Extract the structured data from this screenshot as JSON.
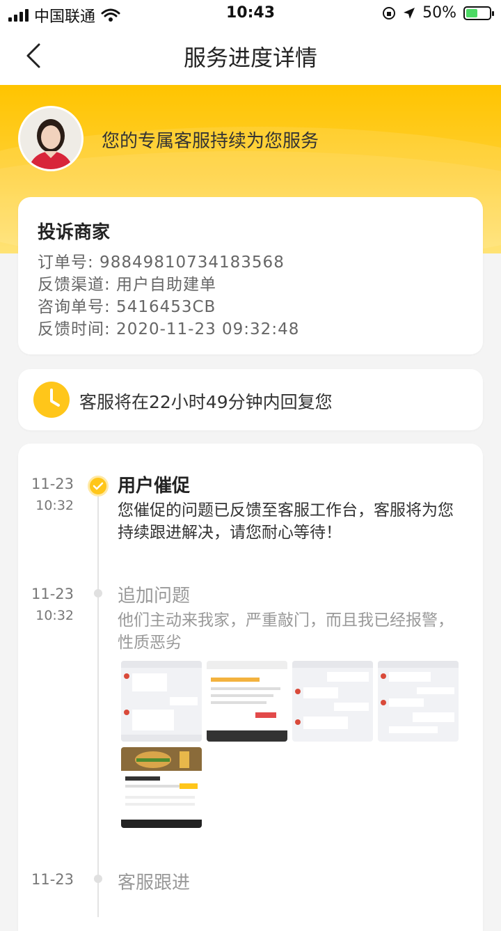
{
  "status_bar": {
    "carrier": "中国联通",
    "time": "10:43",
    "battery": "50%",
    "battery_level": 0.5
  },
  "nav": {
    "title": "服务进度详情",
    "back_icon": "chevron-left-icon"
  },
  "header": {
    "message": "您的专属客服持续为您服务"
  },
  "complaint": {
    "title": "投诉商家",
    "order_no": "订单号: 98849810734183568",
    "channel": "反馈渠道: 用户自助建单",
    "inquiry_no": "咨询单号: 5416453CB",
    "feedback_time": "反馈时间: 2020-11-23 09:32:48"
  },
  "reply_notice": {
    "icon": "clock-icon",
    "text": "客服将在22小时49分钟内回复您"
  },
  "timeline": [
    {
      "date": "11-23",
      "time": "10:32",
      "title": "用户催促",
      "body": "您催促的问题已反馈至客服工作台，客服将为您持续跟进解决，请您耐心等待！",
      "status": "done"
    },
    {
      "date": "11-23",
      "time": "10:32",
      "title": "追加问题",
      "body": "他们主动来我家，严重敲门，而且我已经报警，性质恶劣",
      "attachments": 5
    },
    {
      "date": "11-23",
      "title": "客服跟进"
    }
  ],
  "colors": {
    "accent": "#ffc61a",
    "header_top": "#ffc400",
    "header_bottom": "#ffe16a",
    "muted": "#999999"
  }
}
